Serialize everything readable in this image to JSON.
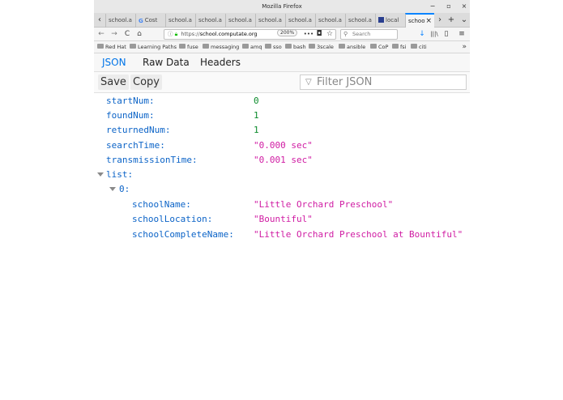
{
  "window": {
    "title": "Mozilla Firefox",
    "minimize": "−",
    "maximize": "▫",
    "close": "×"
  },
  "tabs": [
    {
      "label": "school.a",
      "active": false
    },
    {
      "label": "Cost",
      "active": false,
      "favicon": "google"
    },
    {
      "label": "school.a",
      "active": false
    },
    {
      "label": "school.a",
      "active": false
    },
    {
      "label": "school.a",
      "active": false
    },
    {
      "label": "school.a",
      "active": false
    },
    {
      "label": "school.a",
      "active": false
    },
    {
      "label": "school.a",
      "active": false
    },
    {
      "label": "school.a",
      "active": false
    },
    {
      "label": "local",
      "active": false,
      "favicon": "square"
    },
    {
      "label": "schoo",
      "active": true
    }
  ],
  "tab_controls": {
    "scroll_left": "‹",
    "scroll_right": "›",
    "new_tab": "+",
    "list_all": "⌄",
    "close_tab": "×"
  },
  "navbar": {
    "back": "←",
    "forward": "→",
    "reload": "C",
    "home": "⌂",
    "url_scheme": "https://",
    "url_host": "school.computate.org",
    "zoom": "200%",
    "page_actions": "•••",
    "search_placeholder": "Search",
    "download": "↓",
    "library": "|||\\",
    "sidebar": "▯",
    "menu": "≡"
  },
  "bookmarks": [
    {
      "label": "Red Hat"
    },
    {
      "label": "Learning Paths"
    },
    {
      "label": "fuse"
    },
    {
      "label": "messaging"
    },
    {
      "label": "amq"
    },
    {
      "label": "sso"
    },
    {
      "label": "bash"
    },
    {
      "label": "3scale"
    },
    {
      "label": "ansible"
    },
    {
      "label": "CoP"
    },
    {
      "label": "fsi"
    },
    {
      "label": "citi"
    }
  ],
  "bookmarks_overflow": "»",
  "viewer": {
    "tabs": [
      "JSON",
      "Raw Data",
      "Headers"
    ],
    "selected_tab": "JSON",
    "save_label": "Save",
    "copy_label": "Copy",
    "filter_placeholder": "Filter JSON",
    "filter_icon": "▽"
  },
  "json": {
    "startNum": {
      "key": "startNum:",
      "value": "0"
    },
    "foundNum": {
      "key": "foundNum:",
      "value": "1"
    },
    "returnedNum": {
      "key": "returnedNum:",
      "value": "1"
    },
    "searchTime": {
      "key": "searchTime:",
      "value": "\"0.000 sec\""
    },
    "transmissionTime": {
      "key": "transmissionTime:",
      "value": "\"0.001 sec\""
    },
    "list_key": "list:",
    "item0_key": "0:",
    "schoolName": {
      "key": "schoolName:",
      "value": "\"Little Orchard Preschool\""
    },
    "schoolLocation": {
      "key": "schoolLocation:",
      "value": "\"Bountiful\""
    },
    "schoolCompleteName": {
      "key": "schoolCompleteName:",
      "value": "\"Little Orchard Preschool at Bountiful\""
    }
  },
  "colors": {
    "accent": "#0074e8",
    "key": "#0b63c7",
    "number": "#0a8a2a",
    "string": "#d01ca3"
  }
}
